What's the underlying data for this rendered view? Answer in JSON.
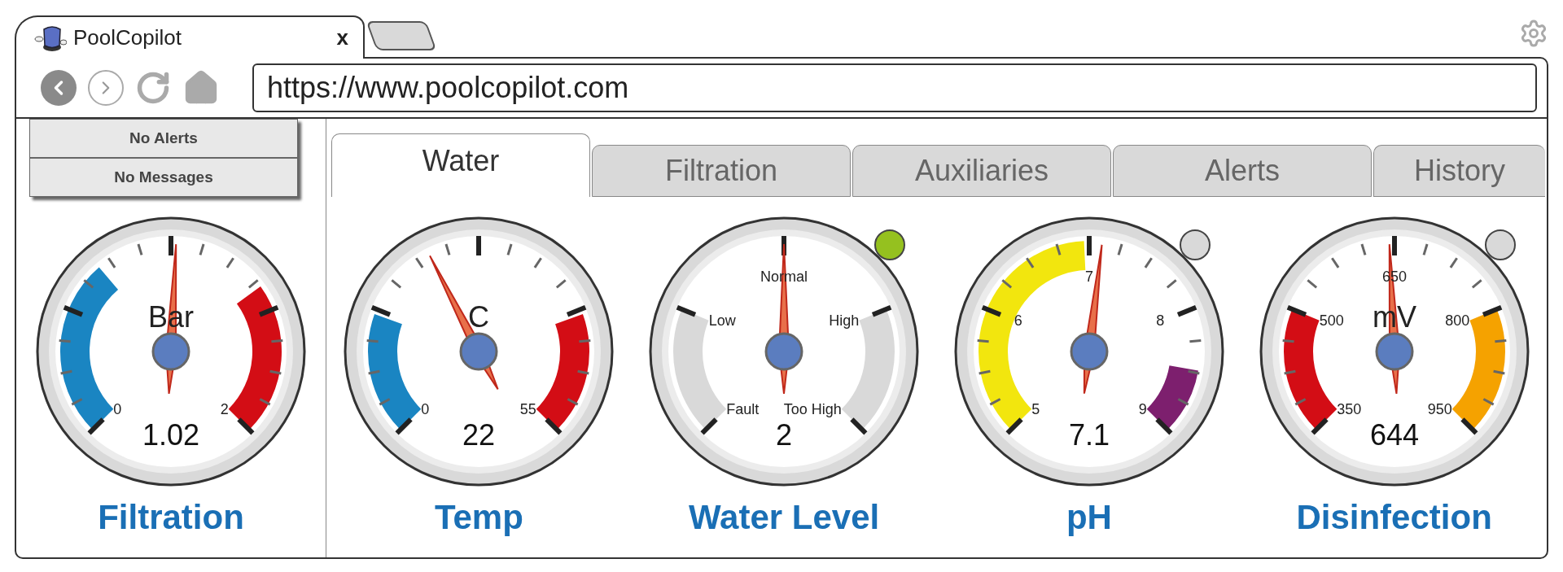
{
  "browser": {
    "tab_title": "PoolCopilot",
    "close": "x",
    "url": "https://www.poolcopilot.com"
  },
  "notices": [
    "No Alerts",
    "No Messages"
  ],
  "side_gauge": {
    "kind": "pressure",
    "title": "Filtration",
    "unit": "Bar",
    "reading": "1.02",
    "level": 0.51,
    "minor_ticks": true,
    "scale_labels": [
      "0",
      "2"
    ]
  },
  "tab_panel": {
    "tabs": [
      {
        "label": "Water",
        "selected": true
      },
      {
        "label": "Filtration",
        "selected": false
      },
      {
        "label": "Auxiliaries",
        "selected": false
      },
      {
        "label": "Alerts",
        "selected": false
      },
      {
        "label": "History",
        "selected": false
      }
    ],
    "gauges": [
      {
        "kind": "temperature",
        "title": "Temp",
        "unit": "C",
        "reading": "22",
        "level": 0.4,
        "minor_ticks": true,
        "scale_labels": [
          "0",
          "55"
        ]
      },
      {
        "kind": "level",
        "title": "Water Level",
        "reading": "2",
        "level": 0.5,
        "minor_ticks": false,
        "scale_labels": [
          "Fault",
          "Low",
          "Normal",
          "High",
          "Too High"
        ],
        "indicator": {
          "color": "#95c11f"
        }
      },
      {
        "kind": "ph",
        "title": "pH",
        "reading": "7.1",
        "level": 0.525,
        "minor_ticks": true,
        "scale_labels": [
          "5",
          "6",
          "7",
          "8",
          "9"
        ],
        "indicator": {
          "color": "#d9d9d9"
        }
      },
      {
        "kind": "redox",
        "title": "Disinfection",
        "unit": "mV",
        "reading": "644",
        "level": 0.49,
        "minor_ticks": true,
        "scale_labels": [
          "350",
          "500",
          "650",
          "800",
          "950"
        ],
        "indicator": {
          "color": "#d9d9d9"
        }
      }
    ]
  }
}
